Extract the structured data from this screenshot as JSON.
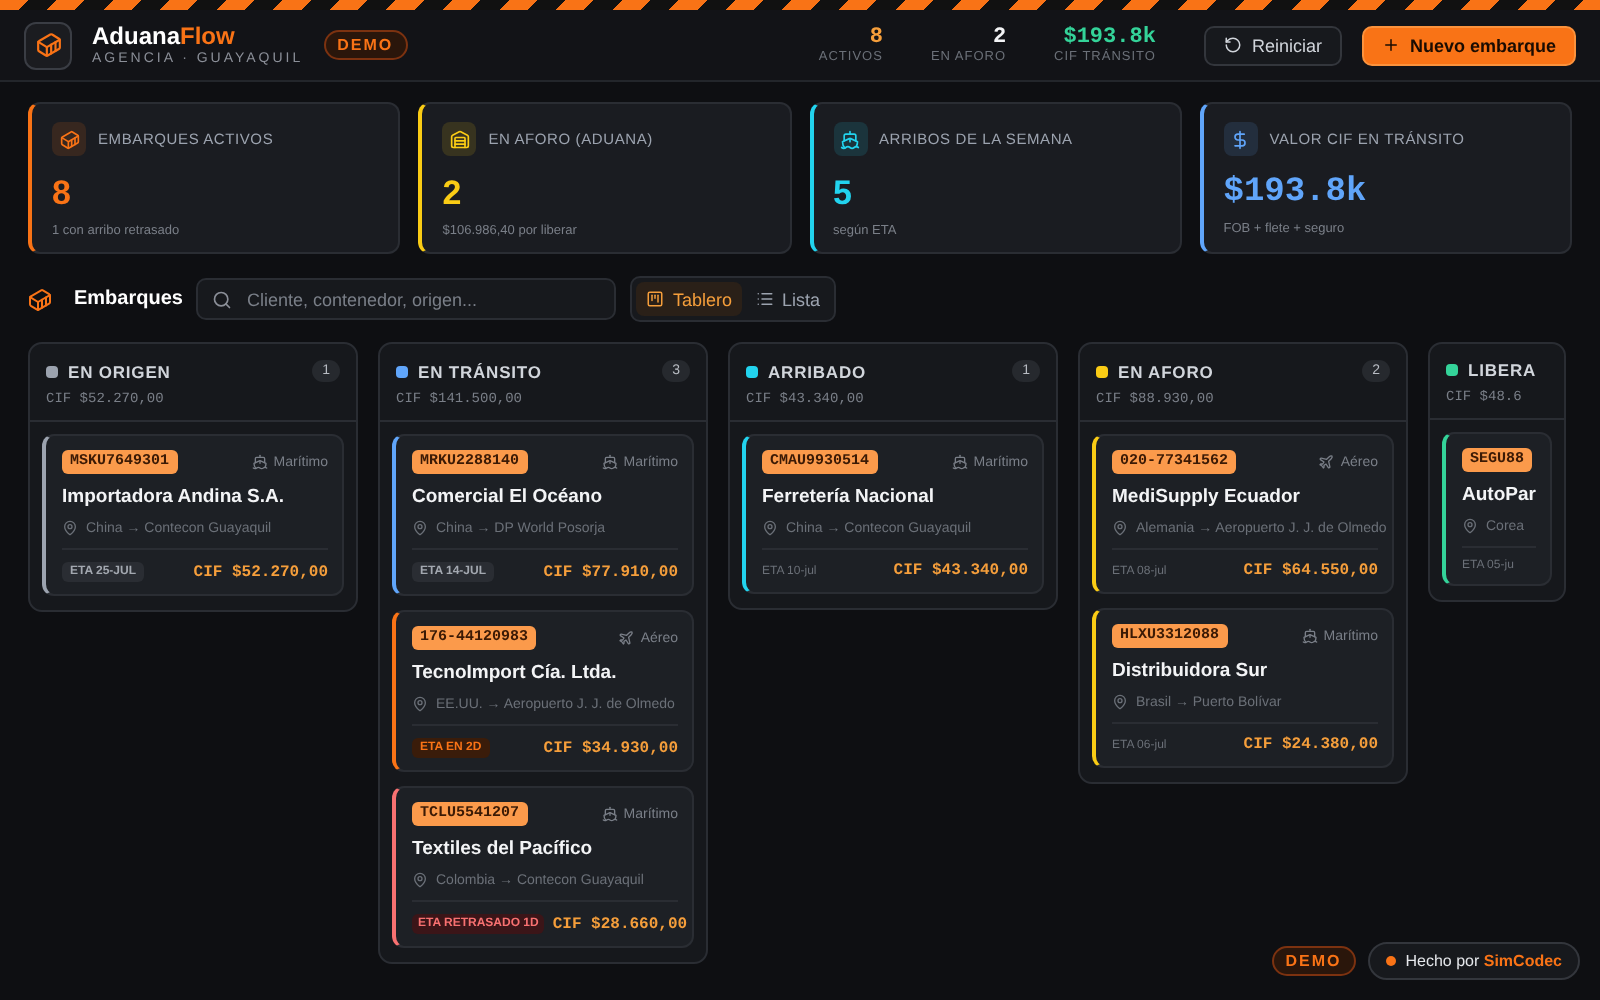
{
  "header": {
    "brand_main": "Aduana",
    "brand_accent": "Flow",
    "subtitle": "AGENCIA · GUAYAQUIL",
    "badge": "DEMO",
    "stats": [
      {
        "value": "8",
        "label": "ACTIVOS",
        "color": "#f59e3b"
      },
      {
        "value": "2",
        "label": "EN AFORO",
        "color": "#f3f4f6"
      },
      {
        "value": "$193.8k",
        "label": "CIF TRÁNSITO",
        "color": "#34d399"
      }
    ],
    "buttons": [
      {
        "label": "Reiniciar",
        "kind": "secondary"
      },
      {
        "label": "Nuevo embarque",
        "kind": "primary"
      }
    ]
  },
  "kpis": [
    {
      "kind": "container",
      "title": "EMBARQUES ACTIVOS",
      "value": "8",
      "note": "1 con arribo retrasado",
      "color": "#f97316"
    },
    {
      "kind": "warehouse",
      "title": "EN AFORO (ADUANA)",
      "value": "2",
      "note": "$106.986,40 por liberar",
      "color": "#facc15"
    },
    {
      "kind": "arrival",
      "title": "ARRIBOS DE LA SEMANA",
      "value": "5",
      "note": "según ETA",
      "color": "#22d3ee"
    },
    {
      "kind": "money",
      "title": "VALOR CIF EN TRÁNSITO",
      "value": "$193.8k",
      "note": "FOB + flete + seguro",
      "color": "#60a5fa"
    }
  ],
  "toolbar": {
    "title": "Embarques",
    "search": {
      "placeholder": "Cliente, contenedor, origen..."
    },
    "views": [
      {
        "kind": "board",
        "label": "Tablero",
        "selected": true
      },
      {
        "kind": "list",
        "label": "Lista",
        "selected": false
      }
    ]
  },
  "board": {
    "columns": [
      {
        "title": "EN ORIGEN",
        "color": "#9ca3af",
        "count": "1",
        "total": "CIF $52.270,00",
        "shipments": [
          {
            "code": "MSKU7649301",
            "mode": {
              "kind": "sea",
              "label": "Marítimo"
            },
            "client": "Importadora Andina S.A.",
            "route": "China → Contecon Guayaquil",
            "eta": {
              "kind": "badge",
              "text": "ETA 25-JUL"
            },
            "cif": "CIF $52.270,00"
          }
        ]
      },
      {
        "title": "EN TRÁNSITO",
        "color": "#60a5fa",
        "count": "3",
        "total": "CIF $141.500,00",
        "shipments": [
          {
            "code": "MRKU2288140",
            "mode": {
              "kind": "sea",
              "label": "Marítimo"
            },
            "client": "Comercial El Océano",
            "route": "China → DP World Posorja",
            "eta": {
              "kind": "badge",
              "text": "ETA 14-JUL"
            },
            "cif": "CIF $77.910,00"
          },
          {
            "code": "176-44120983",
            "mode": {
              "kind": "air",
              "label": "Aéreo"
            },
            "client": "TecnoImport Cía. Ltda.",
            "route": "EE.UU. → Aeropuerto J. J. de Olmedo",
            "eta": {
              "kind": "soon",
              "text": "ETA EN 2D"
            },
            "cif": "CIF $34.930,00"
          },
          {
            "code": "TCLU5541207",
            "mode": {
              "kind": "sea",
              "label": "Marítimo"
            },
            "client": "Textiles del Pacífico",
            "route": "Colombia → Contecon Guayaquil",
            "eta": {
              "kind": "delayed",
              "text": "ETA RETRASADO 1D"
            },
            "cif": "CIF $28.660,00"
          }
        ]
      },
      {
        "title": "ARRIBADO",
        "color": "#22d3ee",
        "count": "1",
        "total": "CIF $43.340,00",
        "shipments": [
          {
            "code": "CMAU9930514",
            "mode": {
              "kind": "sea",
              "label": "Marítimo"
            },
            "client": "Ferretería Nacional",
            "route": "China → Contecon Guayaquil",
            "eta": {
              "kind": "plain",
              "text": "ETA 10-jul"
            },
            "cif": "CIF $43.340,00"
          }
        ]
      },
      {
        "title": "EN AFORO",
        "color": "#facc15",
        "count": "2",
        "total": "CIF $88.930,00",
        "shipments": [
          {
            "code": "020-77341562",
            "mode": {
              "kind": "air",
              "label": "Aéreo"
            },
            "client": "MediSupply Ecuador",
            "route": "Alemania → Aeropuerto J. J. de Olmedo",
            "eta": {
              "kind": "plain",
              "text": "ETA 08-jul"
            },
            "cif": "CIF $64.550,00"
          },
          {
            "code": "HLXU3312088",
            "mode": {
              "kind": "sea",
              "label": "Marítimo"
            },
            "client": "Distribuidora Sur",
            "route": "Brasil → Puerto Bolívar",
            "eta": {
              "kind": "plain",
              "text": "ETA 06-jul"
            },
            "cif": "CIF $24.380,00"
          }
        ]
      },
      {
        "title": "LIBERA",
        "color": "#34d399",
        "total": "CIF $48.6",
        "shipments": [
          {
            "code": "SEGU88",
            "client": "AutoPar",
            "route": "Corea",
            "eta": {
              "kind": "plain",
              "text": "ETA 05-ju"
            }
          }
        ]
      }
    ]
  },
  "footer": {
    "badge": "DEMO",
    "credit_prefix": "Hecho por",
    "credit_brand": "SimCodec"
  }
}
